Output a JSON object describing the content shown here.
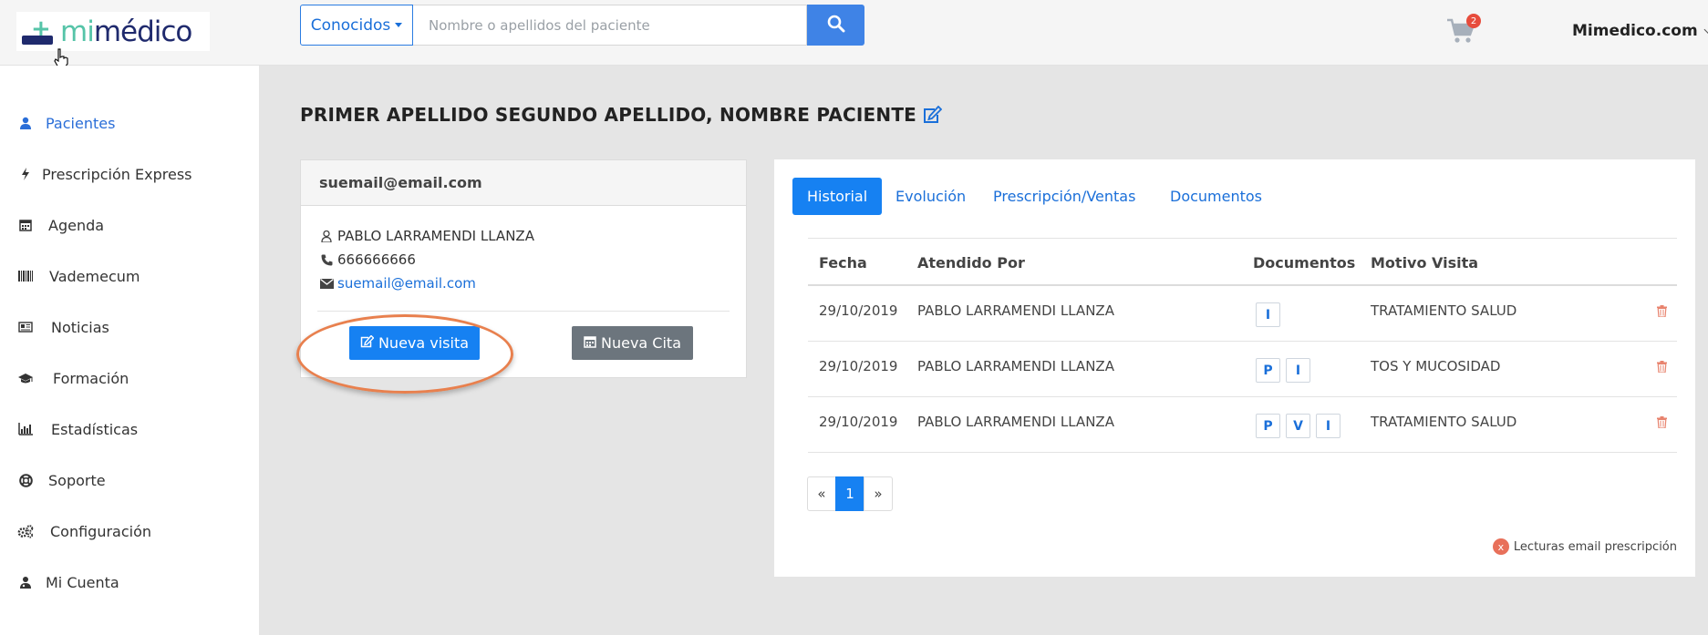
{
  "app": {
    "logo_mi": "mi",
    "logo_medico": "médico"
  },
  "header": {
    "search_scope": "Conocidos",
    "search_placeholder": "Nombre o apellidos del paciente",
    "cart_count": "2",
    "user_menu": "Mimedico.com"
  },
  "sidebar": {
    "items": [
      {
        "label": "Pacientes",
        "icon": "user-icon",
        "active": true
      },
      {
        "label": "Prescripción Express",
        "icon": "bolt-icon"
      },
      {
        "label": "Agenda",
        "icon": "calendar-icon"
      },
      {
        "label": "Vademecum",
        "icon": "barcode-icon"
      },
      {
        "label": "Noticias",
        "icon": "newspaper-icon"
      },
      {
        "label": "Formación",
        "icon": "graduation-cap-icon"
      },
      {
        "label": "Estadísticas",
        "icon": "bar-chart-icon"
      },
      {
        "label": "Soporte",
        "icon": "life-ring-icon"
      },
      {
        "label": "Configuración",
        "icon": "cogs-icon"
      },
      {
        "label": "Mi Cuenta",
        "icon": "user-md-icon"
      }
    ]
  },
  "patient": {
    "title": "PRIMER APELLIDO SEGUNDO APELLIDO, NOMBRE PACIENTE",
    "card_header": "suemail@email.com",
    "doctor": "PABLO LARRAMENDI LLANZA",
    "phone": "666666666",
    "email": "suemail@email.com",
    "new_visit_label": "Nueva visita",
    "new_appointment_label": "Nueva Cita"
  },
  "tabs": [
    {
      "label": "Historial",
      "active": true
    },
    {
      "label": "Evolución"
    },
    {
      "label": "Prescripción/Ventas"
    },
    {
      "label": "Documentos"
    }
  ],
  "table": {
    "headers": [
      "Fecha",
      "Atendido Por",
      "Documentos",
      "Motivo Visita"
    ],
    "rows": [
      {
        "fecha": "29/10/2019",
        "atendido": "PABLO LARRAMENDI LLANZA",
        "docs": [
          "I"
        ],
        "motivo": "TRATAMIENTO SALUD"
      },
      {
        "fecha": "29/10/2019",
        "atendido": "PABLO LARRAMENDI LLANZA",
        "docs": [
          "P",
          "I"
        ],
        "motivo": "TOS Y MUCOSIDAD"
      },
      {
        "fecha": "29/10/2019",
        "atendido": "PABLO LARRAMENDI LLANZA",
        "docs": [
          "P",
          "V",
          "I"
        ],
        "motivo": "TRATAMIENTO SALUD"
      }
    ]
  },
  "pagination": {
    "prev": "«",
    "current": "1",
    "next": "»"
  },
  "legend": {
    "marker": "x",
    "label": "Lecturas email prescripción"
  },
  "colors": {
    "primary": "#1681f2",
    "secondary": "#6c757d",
    "highlight": "#e8804e",
    "brand_green": "#56c4a8",
    "brand_navy": "#1f2a6d"
  }
}
